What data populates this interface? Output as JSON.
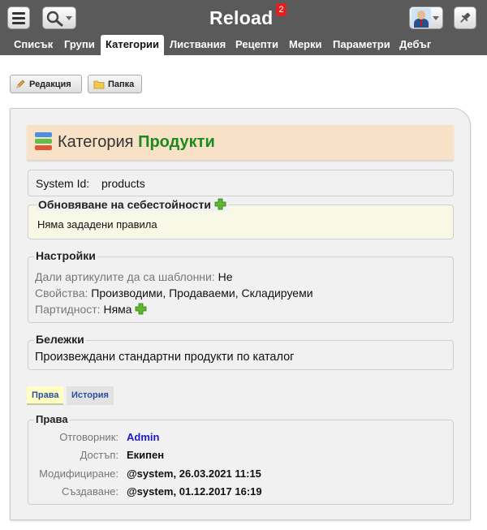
{
  "header": {
    "app_title": "Reload",
    "notifications_count": "2",
    "menu_icon": "hamburger-icon",
    "search_icon": "search-icon",
    "pin_icon": "pin-icon"
  },
  "nav": {
    "items": [
      {
        "label": "Списък"
      },
      {
        "label": "Групи"
      },
      {
        "label": "Категории"
      },
      {
        "label": "Листвания"
      },
      {
        "label": "Рецепти"
      },
      {
        "label": "Мерки"
      },
      {
        "label": "Параметри"
      },
      {
        "label": "Дебъг"
      }
    ],
    "active": "Категории"
  },
  "toolbar": {
    "edit_label": "Редакция",
    "folder_label": "Папка"
  },
  "category": {
    "title_prefix": "Категория",
    "title_name": "Продукти",
    "system_id_label": "System Id:",
    "system_id_value": "products"
  },
  "cost_update": {
    "legend": "Обновяване на себестойности",
    "text": "Няма зададени правила"
  },
  "settings": {
    "legend": "Настройки",
    "rows": [
      {
        "label": "Дали артикулите да са шаблонни:",
        "value": "Не"
      },
      {
        "label": "Свойства:",
        "value": "Производими, Продаваеми, Складируеми"
      },
      {
        "label": "Партидност:",
        "value": "Няма"
      }
    ]
  },
  "notes": {
    "legend": "Бележки",
    "text": "Произвеждани стандартни продукти по каталог"
  },
  "tabs": [
    {
      "label": "Права"
    },
    {
      "label": "История"
    }
  ],
  "rights": {
    "legend": "Права",
    "rows": [
      {
        "label": "Отговорник:",
        "value": "Admin"
      },
      {
        "label": "Достъп:",
        "value": "Екипен"
      },
      {
        "label": "Модифициране:",
        "value": "@system, 26.03.2021 11:15"
      },
      {
        "label": "Създаване:",
        "value": "@system, 01.12.2017 16:19"
      }
    ]
  },
  "colors": {
    "header_bg": "#5a5a5a",
    "category_name": "#1d8a1d",
    "link_blue": "#1a1ac8",
    "cost_box_bg": "#f8f8e6",
    "plus_green": "#4caf2a"
  }
}
